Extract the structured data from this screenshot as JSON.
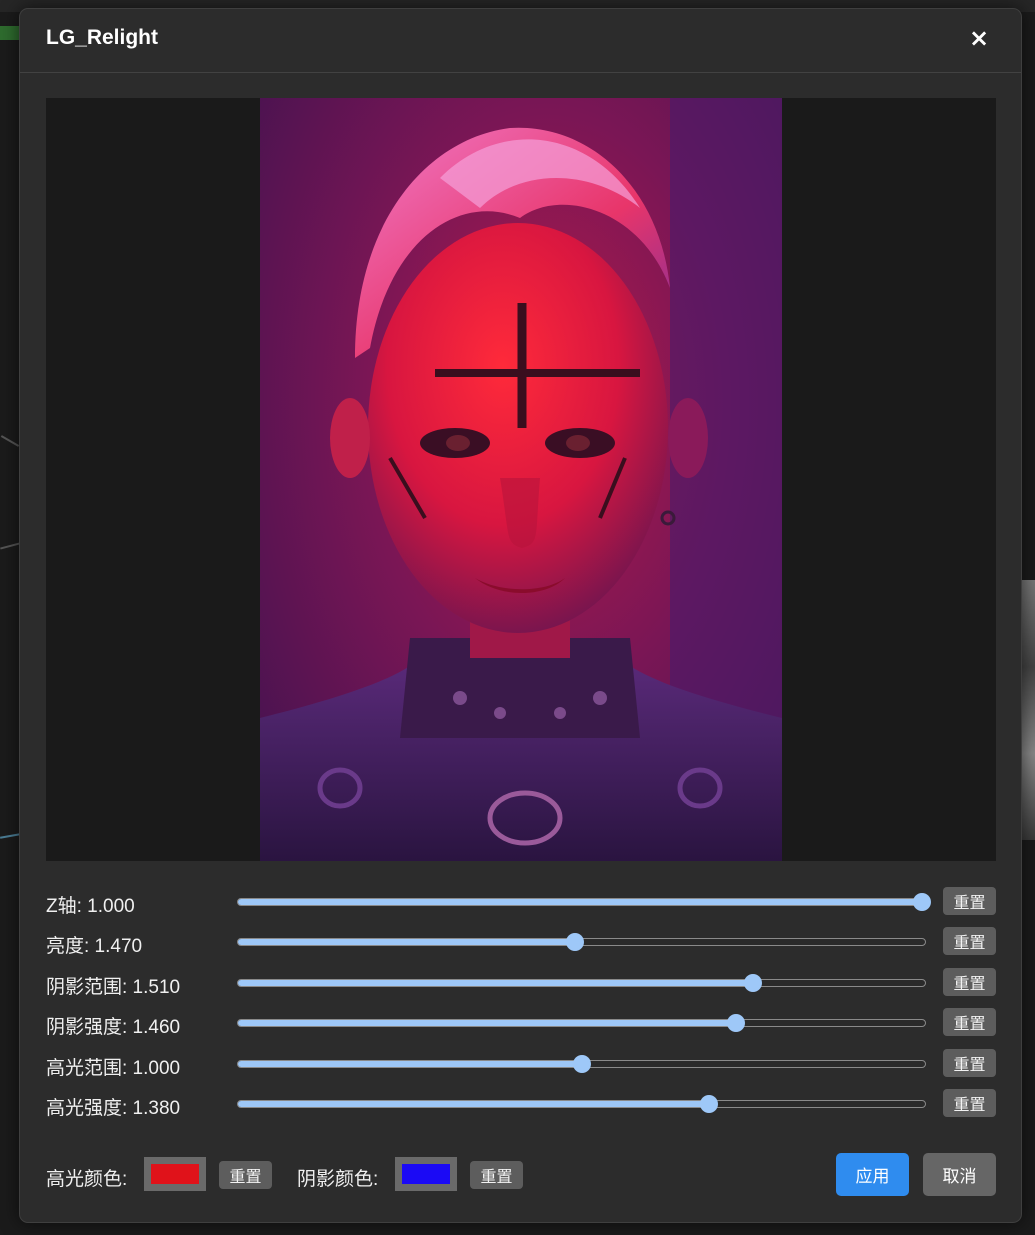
{
  "dialog": {
    "title": "LG_Relight",
    "close_glyph": "×"
  },
  "preview": {
    "image_icon": "relit-portrait-image"
  },
  "sliders": [
    {
      "label": "Z轴: 1.000",
      "percent": 99.5,
      "reset_label": "重置"
    },
    {
      "label": "亮度: 1.470",
      "percent": 49.0,
      "reset_label": "重置"
    },
    {
      "label": "阴影范围: 1.510",
      "percent": 75.0,
      "reset_label": "重置"
    },
    {
      "label": "阴影强度: 1.460",
      "percent": 72.5,
      "reset_label": "重置"
    },
    {
      "label": "高光范围: 1.000",
      "percent": 50.0,
      "reset_label": "重置"
    },
    {
      "label": "高光强度: 1.380",
      "percent": 68.5,
      "reset_label": "重置"
    }
  ],
  "colors": {
    "highlight_label": "高光颜色:",
    "highlight_color": "#e0121a",
    "highlight_reset": "重置",
    "shadow_label": "阴影颜色:",
    "shadow_color": "#1b0af5",
    "shadow_reset": "重置"
  },
  "actions": {
    "apply_label": "应用",
    "cancel_label": "取消"
  },
  "theme": {
    "accent": "#2f8cef",
    "slider": "#9ec8f8"
  }
}
